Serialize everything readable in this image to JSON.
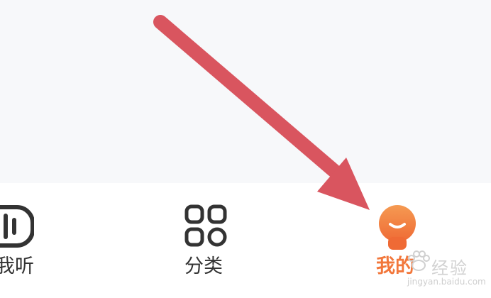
{
  "tabbar": {
    "tabs": [
      {
        "key": "listen",
        "label": "我听",
        "icon": "waveform-icon",
        "active": false
      },
      {
        "key": "category",
        "label": "分类",
        "icon": "grid-icon",
        "active": false
      },
      {
        "key": "mine",
        "label": "我的",
        "icon": "profile-mascot-icon",
        "active": true
      }
    ]
  },
  "colors": {
    "content_bg": "#f7f8fa",
    "inactive_icon": "#333333",
    "inactive_text": "#333333",
    "active_accent": "#f2773b",
    "annotation_arrow": "#d9555f"
  },
  "watermark": {
    "main": "经验",
    "sub": "jingyan.baidu.com"
  }
}
